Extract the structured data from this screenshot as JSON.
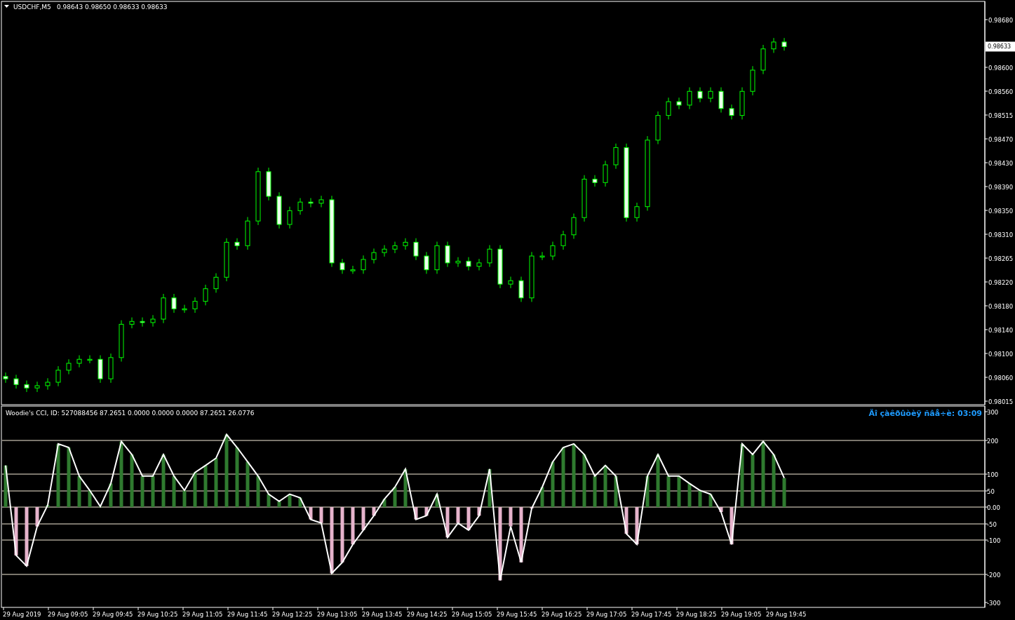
{
  "main_chart": {
    "symbol": "USDCHF,M5",
    "ohlc": "0.98643 0.98650 0.98633 0.98633",
    "current_price": "0.98633",
    "price_labels": [
      "0.98680",
      "0.98600",
      "0.98560",
      "0.98515",
      "0.98470",
      "0.98430",
      "0.98390",
      "0.98350",
      "0.98310",
      "0.98265",
      "0.98220",
      "0.98180",
      "0.98140",
      "0.98100",
      "0.98060",
      "0.98015"
    ]
  },
  "cci_pane": {
    "title": "Woodie's CCI, ID: 527088456 87.2651 0.0000 0.0000 0.0000 87.2651 26.0776",
    "timer": "Äî çàêðûòèÿ ñâå÷è: 03:09",
    "scale_labels": [
      "300",
      "200",
      "100",
      "50",
      "0.00",
      "-50",
      "-100",
      "-200",
      "-300"
    ]
  },
  "time_axis": {
    "labels": [
      "29 Aug 2019",
      "29 Aug 09:05",
      "29 Aug 09:45",
      "29 Aug 10:25",
      "29 Aug 11:05",
      "29 Aug 11:45",
      "29 Aug 12:25",
      "29 Aug 13:05",
      "29 Aug 13:45",
      "29 Aug 14:25",
      "29 Aug 15:05",
      "29 Aug 15:45",
      "29 Aug 16:25",
      "29 Aug 17:05",
      "29 Aug 17:45",
      "29 Aug 18:25",
      "29 Aug 19:05",
      "29 Aug 19:45"
    ]
  }
}
